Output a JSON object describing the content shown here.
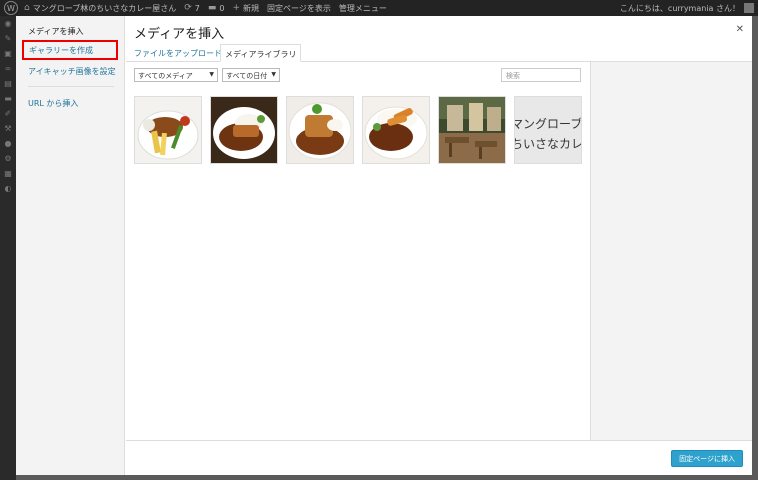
{
  "admin_bar": {
    "site_name": "マングローブ林のちいさなカレー屋さん",
    "updates_count": "7",
    "comments_count": "0",
    "new_label": "新規",
    "view_page_label": "固定ページを表示",
    "manage_menu_label": "管理メニュー",
    "greeting": "こんにちは、currymania さん！"
  },
  "modal": {
    "sidebar_title": "メディアを挿入",
    "menu": {
      "create_gallery": "ギャラリーを作成",
      "featured_image": "アイキャッチ画像を設定",
      "insert_from_url": "URL から挿入"
    },
    "title": "メディアを挿入",
    "close_icon": "close-icon",
    "tabs": [
      {
        "label": "ファイルをアップロード"
      },
      {
        "label": "メディアライブラリ"
      }
    ],
    "filters": {
      "media_type": "すべてのメディア",
      "date": "すべての日付"
    },
    "search_placeholder": "検索",
    "thumbnails": [
      {
        "type": "image",
        "subject": "curry-with-vegetables"
      },
      {
        "type": "image",
        "subject": "katsu-curry-plate"
      },
      {
        "type": "image",
        "subject": "katsu-curry-plate-2"
      },
      {
        "type": "image",
        "subject": "ebi-fry-curry"
      },
      {
        "type": "image",
        "subject": "restaurant-terrace"
      },
      {
        "type": "text",
        "line1": "マングローブ林",
        "line2": "ちいさなカレー"
      }
    ],
    "insert_button": "固定ページに挿入"
  },
  "colors": {
    "accent": "#21759b",
    "button": "#2ea2cc",
    "highlight": "#ee0000"
  }
}
